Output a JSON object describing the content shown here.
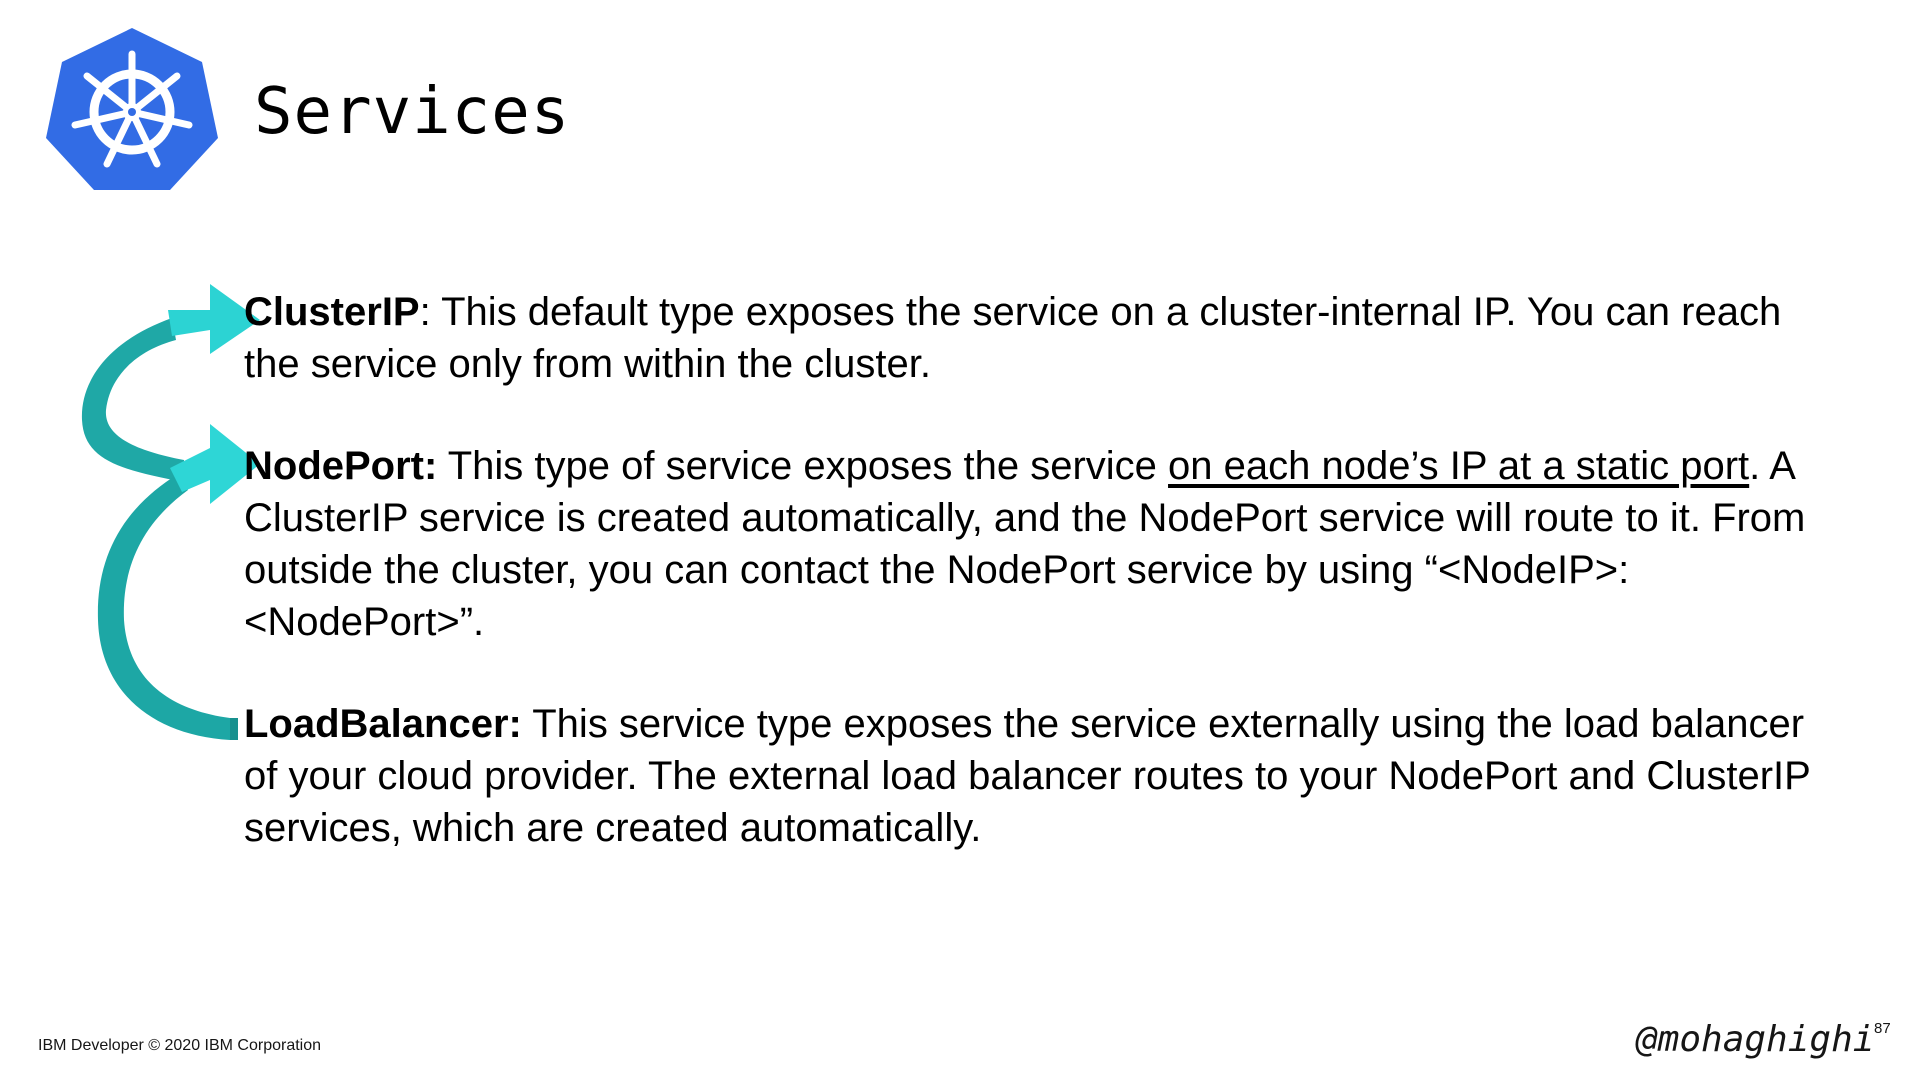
{
  "slide": {
    "title": "Services",
    "logo_icon": "kubernetes-helm-wheel-icon",
    "accent_colors": {
      "logo_blue": "#326CE5",
      "arrow_teal": "#2BC4C8",
      "arrow_dark": "#1A9E9A"
    }
  },
  "items": [
    {
      "term": "ClusterIP",
      "sep": ":",
      "text": " This default type exposes the service on a cluster-internal IP. You can reach the service only from within the cluster."
    },
    {
      "term": "NodePort:",
      "pre": " This type of service exposes the service ",
      "underlined": "on each node’s IP at a static port",
      "post": ". A ClusterIP service is created automatically, and the NodePort service will route to it. From outside the cluster, you can contact the NodePort service by using “<NodeIP>:<NodePort>”."
    },
    {
      "term": "LoadBalancer:",
      "text": " This service type exposes the service externally using the load balancer of your cloud provider. The external load balancer routes to your NodePort and ClusterIP services, which are created automatically."
    }
  ],
  "footer": {
    "copyright": "IBM Developer © 2020 IBM Corporation",
    "handle": "@mohaghighi",
    "page_number": "87"
  }
}
